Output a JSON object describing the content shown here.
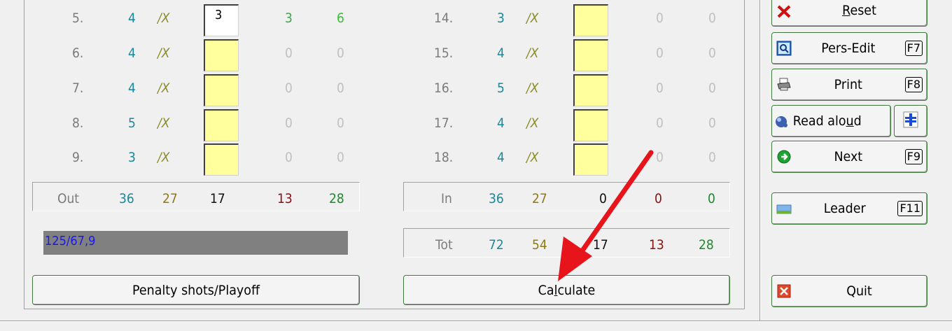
{
  "holes_front": [
    {
      "no": "5.",
      "par": "4",
      "hcp": "/X",
      "score": "3",
      "s1": "3",
      "s2": "6",
      "active": true
    },
    {
      "no": "6.",
      "par": "4",
      "hcp": "/X",
      "score": "",
      "s1": "0",
      "s2": "0",
      "active": false
    },
    {
      "no": "7.",
      "par": "4",
      "hcp": "/X",
      "score": "",
      "s1": "0",
      "s2": "0",
      "active": false
    },
    {
      "no": "8.",
      "par": "5",
      "hcp": "/X",
      "score": "",
      "s1": "0",
      "s2": "0",
      "active": false
    },
    {
      "no": "9.",
      "par": "3",
      "hcp": "/X",
      "score": "",
      "s1": "0",
      "s2": "0",
      "active": false
    }
  ],
  "holes_back": [
    {
      "no": "14.",
      "par": "3",
      "hcp": "/X",
      "score": "",
      "s1": "0",
      "s2": "0"
    },
    {
      "no": "15.",
      "par": "4",
      "hcp": "/X",
      "score": "",
      "s1": "0",
      "s2": "0"
    },
    {
      "no": "16.",
      "par": "5",
      "hcp": "/X",
      "score": "",
      "s1": "0",
      "s2": "0"
    },
    {
      "no": "17.",
      "par": "4",
      "hcp": "/X",
      "score": "",
      "s1": "0",
      "s2": "0"
    },
    {
      "no": "18.",
      "par": "4",
      "hcp": "/X",
      "score": "",
      "s1": "0",
      "s2": "0"
    }
  ],
  "out_row": {
    "label": "Out",
    "par": "36",
    "hcp": "27",
    "strokes": "17",
    "red": "13",
    "green": "28"
  },
  "in_row": {
    "label": "In",
    "par": "36",
    "hcp": "27",
    "strokes": "0",
    "red": "0",
    "green": "0"
  },
  "tot_row": {
    "label": "Tot",
    "par": "72",
    "hcp": "54",
    "strokes": "17",
    "red": "13",
    "green": "28"
  },
  "progress_text": "125/67,9",
  "buttons": {
    "penalty": "Penalty shots/Playoff",
    "calculate_pre": "Ca",
    "calculate_ul": "l",
    "calculate_post": "culate",
    "reset_ul": "R",
    "reset_post": "eset",
    "pers_edit": "Pers-Edit",
    "pers_edit_key": "F7",
    "print": "Print",
    "print_key": "F8",
    "read_aloud_pre": "Read alo",
    "read_aloud_ul": "u",
    "read_aloud_post": "d",
    "next": "Next",
    "next_key": "F9",
    "leader": "Leader",
    "leader_key": "F11",
    "quit": "Quit"
  },
  "colors": {
    "arrow": "#e8141c",
    "yellow_field": "#ffff9e",
    "accent_green": "#3b7a3b"
  }
}
